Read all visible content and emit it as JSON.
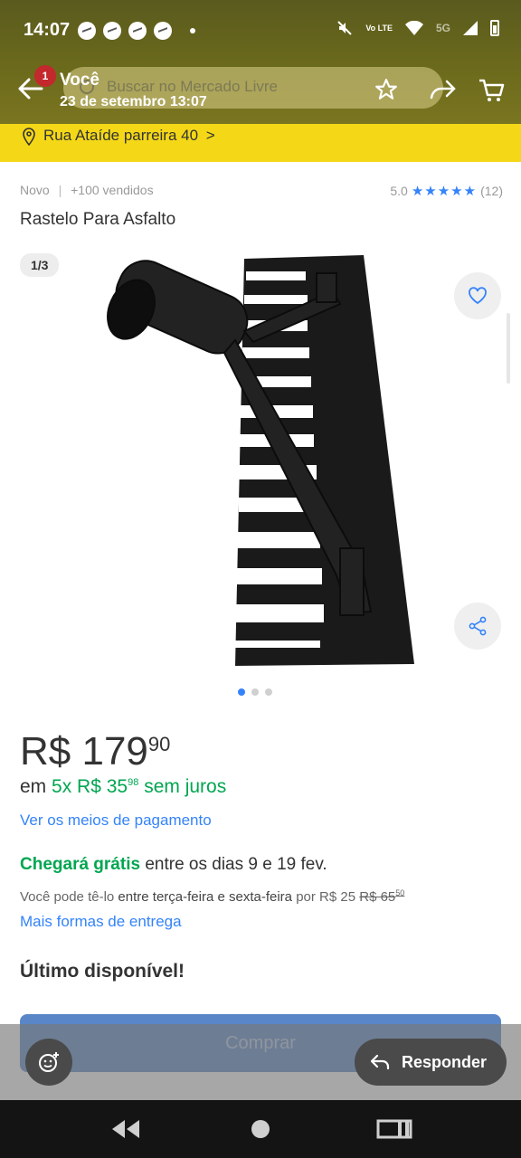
{
  "status_bar": {
    "time": "14:07",
    "network": "Vo LTE",
    "signal": "5G"
  },
  "header": {
    "back_icon": "arrow-left-icon",
    "notification_count": "1",
    "sender": "Você",
    "date": "23 de setembro 13:07",
    "search_placeholder": "Buscar no Mercado Livre",
    "star_icon": "star-icon",
    "share_icon": "share-arrow-icon",
    "cart_icon": "cart-icon"
  },
  "address": {
    "text": "Rua Ataíde parreira 40",
    "chevron": ">"
  },
  "product": {
    "condition": "Novo",
    "separator": "|",
    "sold": "+100 vendidos",
    "rating_value": "5.0",
    "stars": "★★★★★",
    "rating_count": "(12)",
    "title": "Rastelo Para Asfalto",
    "image_counter": "1/3"
  },
  "pricing": {
    "currency": "R$",
    "integer": "179",
    "cents": "90",
    "installment_prefix": "em",
    "installment_main": "5x R$ 35",
    "installment_cents": "98",
    "installment_suffix": "sem juros",
    "payment_link": "Ver os meios de pagamento"
  },
  "shipping": {
    "free_label": "Chegará grátis",
    "free_rest": "entre os dias 9 e 19 fev.",
    "pickup_prefix": "Você pode tê-lo",
    "pickup_days": "entre terça-feira e sexta-feira",
    "pickup_price": "por R$ 25",
    "pickup_old_price": "R$ 65",
    "pickup_old_cents": "50",
    "more_link": "Mais formas de entrega"
  },
  "stock": "Último disponível!",
  "actions": {
    "buy": "Comprar",
    "reply": "Responder"
  },
  "colors": {
    "accent": "#3483fa",
    "success": "#00a650",
    "address_bar": "#f4d817",
    "badge": "#c3282d"
  }
}
